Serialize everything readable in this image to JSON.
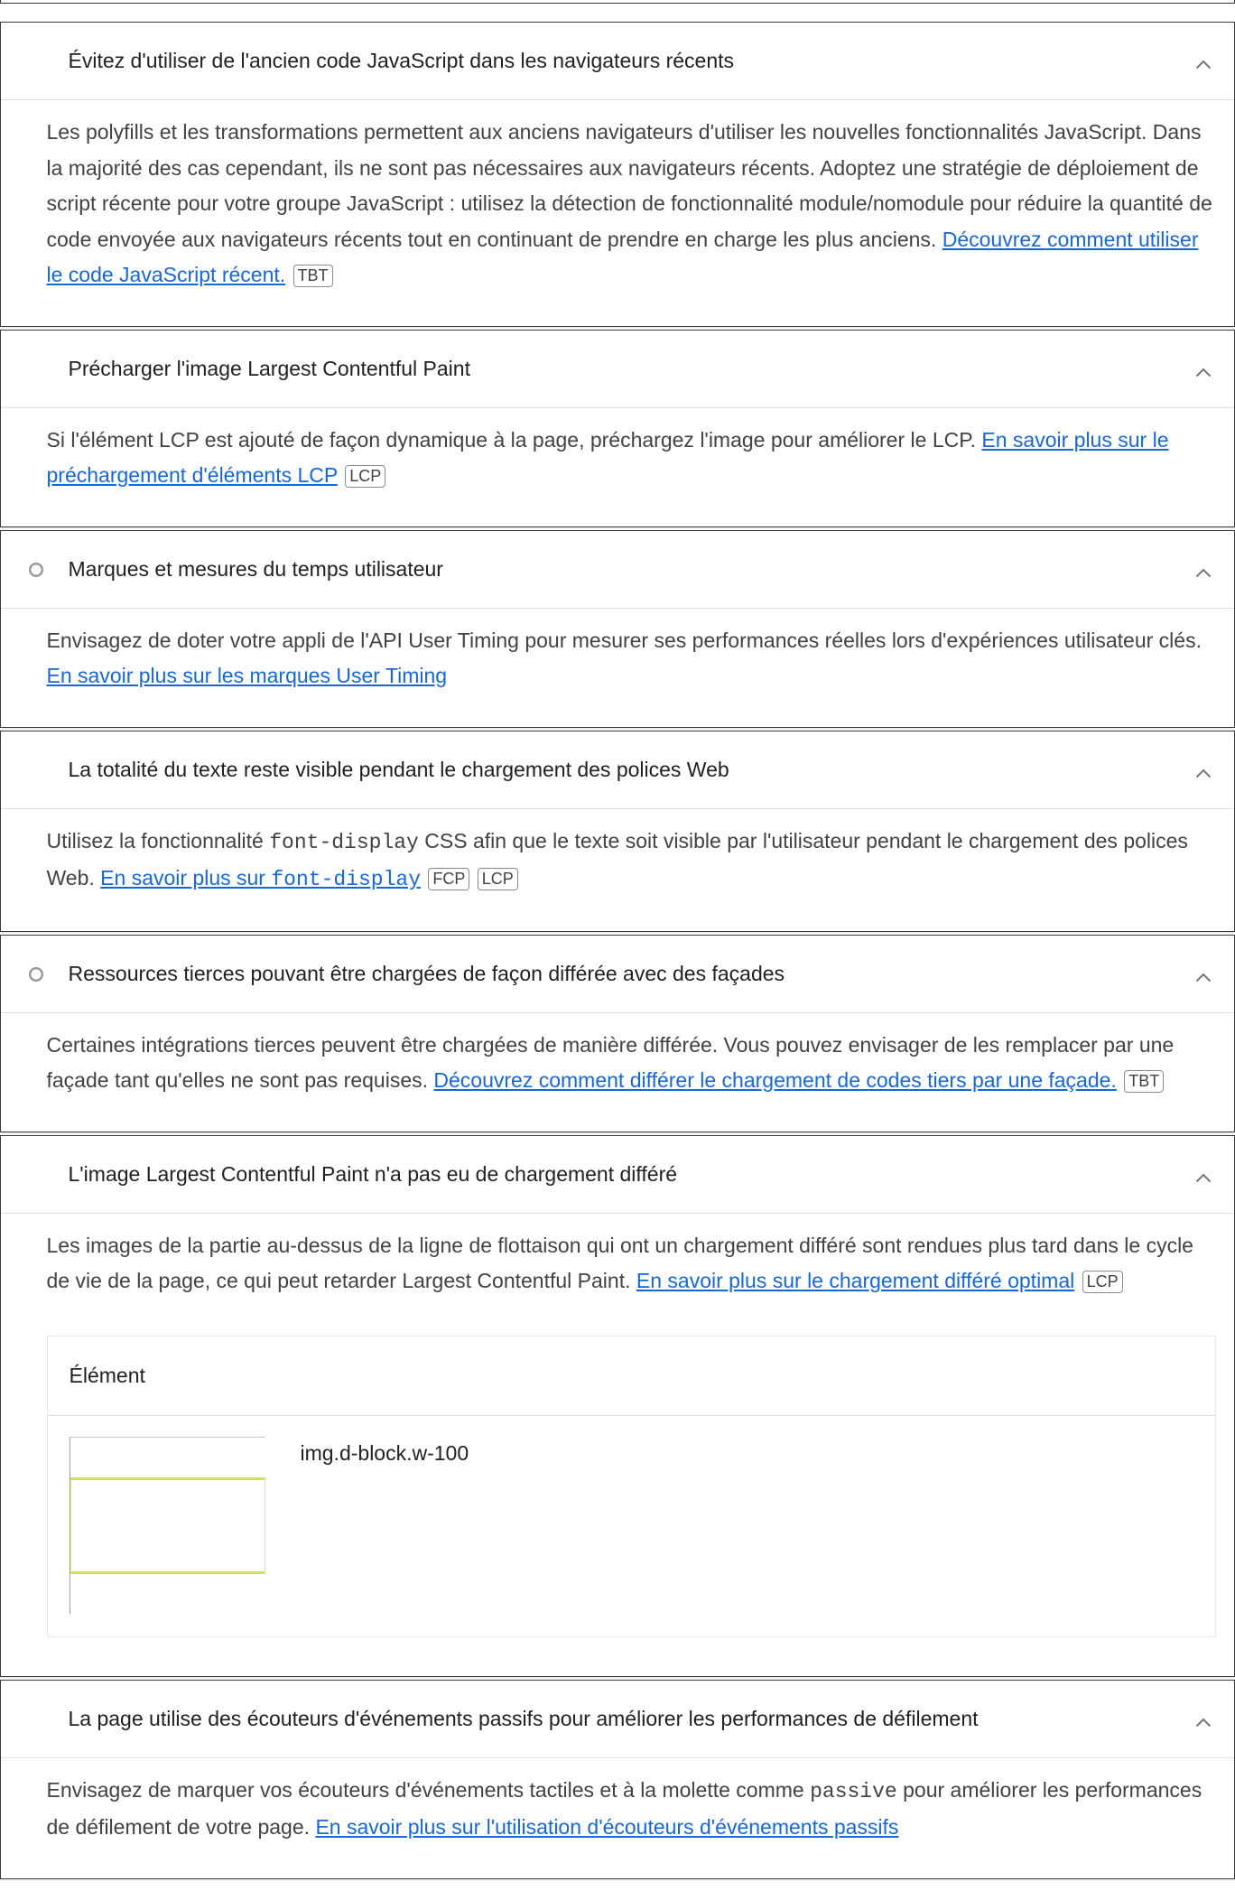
{
  "colors": {
    "link": "#1967d2",
    "title": "#212121",
    "desc": "#424242",
    "border": "#3a3a3a",
    "highlight": "#d5dd66"
  },
  "audits": [
    {
      "title": "Évitez d'utiliser de l'ancien code JavaScript dans les navigateurs récents",
      "description": "Les polyfills et les transformations permettent aux anciens navigateurs d'utiliser les nouvelles fonctionnalités JavaScript. Dans la majorité des cas cependant, ils ne sont pas nécessaires aux navigateurs récents. Adoptez une stratégie de déploiement de script récente pour votre groupe JavaScript : utilisez la détection de fonctionnalité module/nomodule pour réduire la quantité de code envoyée aux navigateurs récents tout en continuant de prendre en charge les plus anciens.",
      "link": "Découvrez comment utiliser le code JavaScript récent.",
      "badges": [
        "TBT"
      ],
      "icon": "chevron-up-icon"
    },
    {
      "title": "Précharger l'image Largest Contentful Paint",
      "description": "Si l'élément LCP est ajouté de façon dynamique à la page, préchargez l'image pour améliorer le LCP.",
      "link": "En savoir plus sur le préchargement d'éléments LCP",
      "badges": [
        "LCP"
      ],
      "icon": "chevron-up-icon"
    },
    {
      "title": "Marques et mesures du temps utilisateur",
      "status_icon": "circle-icon",
      "description": "Envisagez de doter votre appli de l'API User Timing pour mesurer ses performances réelles lors d'expériences utilisateur clés.",
      "link": "En savoir plus sur les marques User Timing",
      "icon": "chevron-up-icon"
    },
    {
      "title": "La totalité du texte reste visible pendant le chargement des polices Web",
      "description_before": "Utilisez la fonctionnalité",
      "description_code": "font-display",
      "description_after": "CSS afin que le texte soit visible par l'utilisateur pendant le chargement des polices Web.",
      "link_text": "En savoir plus sur",
      "link_code": "font-display",
      "badges": [
        "FCP",
        "LCP"
      ],
      "icon": "chevron-up-icon"
    },
    {
      "title": "Ressources tierces pouvant être chargées de façon différée avec des façades",
      "status_icon": "circle-icon",
      "description": "Certaines intégrations tierces peuvent être chargées de manière différée. Vous pouvez envisager de les remplacer par une façade tant qu'elles ne sont pas requises.",
      "link": "Découvrez comment différer le chargement de codes tiers par une façade.",
      "badges": [
        "TBT"
      ],
      "icon": "chevron-up-icon"
    },
    {
      "title": "L'image Largest Contentful Paint n'a pas eu de chargement différé",
      "description": "Les images de la partie au-dessus de la ligne de flottaison qui ont un chargement différé sont rendues plus tard dans le cycle de vie de la page, ce qui peut retarder Largest Contentful Paint.",
      "link": "En savoir plus sur le chargement différé optimal",
      "badges": [
        "LCP"
      ],
      "icon": "chevron-up-icon",
      "table": {
        "header": "Élément",
        "rows": [
          {
            "node": "img.d-block.w-100"
          }
        ]
      }
    },
    {
      "title": "La page utilise des écouteurs d'événements passifs pour améliorer les performances de défilement",
      "description_before": "Envisagez de marquer vos écouteurs d'événements tactiles et à la molette comme",
      "description_code": "passive",
      "description_after": "pour améliorer les performances de défilement de votre page.",
      "link": "En savoir plus sur l'utilisation d'écouteurs d'événements passifs",
      "icon": "chevron-up-icon"
    }
  ]
}
